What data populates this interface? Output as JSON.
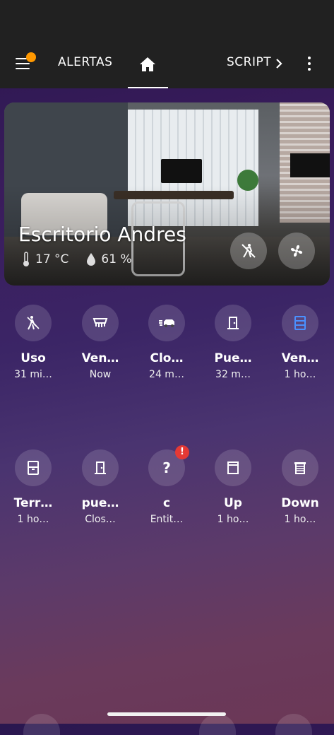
{
  "header": {
    "tabs": {
      "alertas": "ALERTAS",
      "home": "home",
      "script": "SCRIPT"
    },
    "menu_icon": "menu-icon",
    "notification_dot_color": "#ff9800"
  },
  "card": {
    "title": "Escritorio Andres",
    "temperature": "17 °C",
    "humidity": "61 %",
    "buttons": [
      "motion-off-icon",
      "fan-icon"
    ]
  },
  "row1": [
    {
      "name": "Uso",
      "state": "31 mi…",
      "icon": "walk-icon",
      "active": false
    },
    {
      "name": "Ven…",
      "state": "Now",
      "icon": "blinds-icon",
      "active": false
    },
    {
      "name": "Clo…",
      "state": "24 m…",
      "icon": "car-motion-icon",
      "active": false
    },
    {
      "name": "Pue…",
      "state": "32 m…",
      "icon": "door-icon",
      "active": false
    },
    {
      "name": "Ven…",
      "state": "1 ho…",
      "icon": "window-icon",
      "active": true
    }
  ],
  "row2": [
    {
      "name": "Terr…",
      "state": "1 ho…",
      "icon": "window-closed-icon"
    },
    {
      "name": "pue…",
      "state": "Clos…",
      "icon": "door-closed-icon"
    },
    {
      "name": "c",
      "state": "Entit…",
      "icon": "question-icon",
      "badge": "!"
    },
    {
      "name": "Up",
      "state": "1 ho…",
      "icon": "window-shutter-open-icon"
    },
    {
      "name": "Down",
      "state": "1 ho…",
      "icon": "window-shutter-icon"
    }
  ],
  "colors": {
    "accent_active": "#4a90ff",
    "badge": "#e53935",
    "appbar": "#212121"
  }
}
